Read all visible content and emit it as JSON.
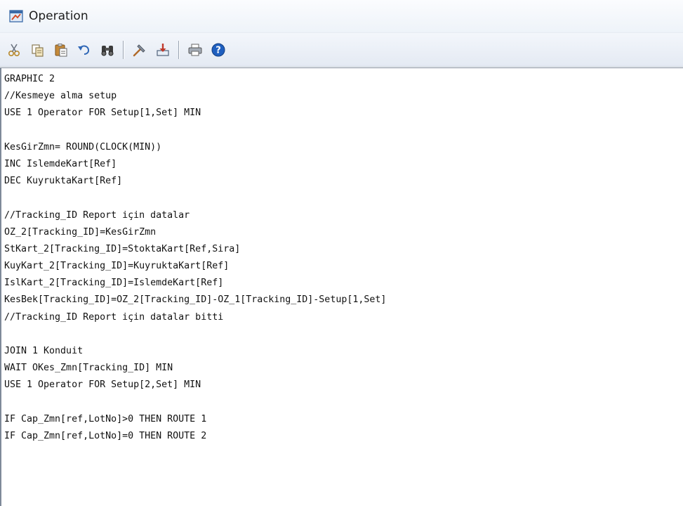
{
  "window": {
    "title": "Operation",
    "icon": "operation-window-icon"
  },
  "toolbar": {
    "buttons": [
      {
        "name": "cut",
        "icon": "scissors-icon"
      },
      {
        "name": "copy",
        "icon": "copy-icon"
      },
      {
        "name": "paste",
        "icon": "clipboard-icon"
      },
      {
        "name": "undo",
        "icon": "undo-icon"
      },
      {
        "name": "find",
        "icon": "binoculars-icon"
      },
      {
        "name": "build",
        "icon": "hammer-icon"
      },
      {
        "name": "insert",
        "icon": "download-icon"
      },
      {
        "name": "print",
        "icon": "printer-icon"
      },
      {
        "name": "help",
        "icon": "help-icon"
      }
    ]
  },
  "editor": {
    "lines": [
      "GRAPHIC 2",
      "//Kesmeye alma setup",
      "USE 1 Operator FOR Setup[1,Set] MIN",
      "",
      "KesGirZmn= ROUND(CLOCK(MIN))",
      "INC IslemdeKart[Ref]",
      "DEC KuyruktaKart[Ref]",
      "",
      "//Tracking_ID Report için datalar",
      "OZ_2[Tracking_ID]=KesGirZmn",
      "StKart_2[Tracking_ID]=StoktaKart[Ref,Sira]",
      "KuyKart_2[Tracking_ID]=KuyruktaKart[Ref]",
      "IslKart_2[Tracking_ID]=IslemdeKart[Ref]",
      "KesBek[Tracking_ID]=OZ_2[Tracking_ID]-OZ_1[Tracking_ID]-Setup[1,Set]",
      "//Tracking_ID Report için datalar bitti",
      "",
      "JOIN 1 Konduit",
      "WAIT OKes_Zmn[Tracking_ID] MIN",
      "USE 1 Operator FOR Setup[2,Set] MIN",
      "",
      "IF Cap_Zmn[ref,LotNo]>0 THEN ROUTE 1",
      "IF Cap_Zmn[ref,LotNo]=0 THEN ROUTE 2"
    ]
  }
}
